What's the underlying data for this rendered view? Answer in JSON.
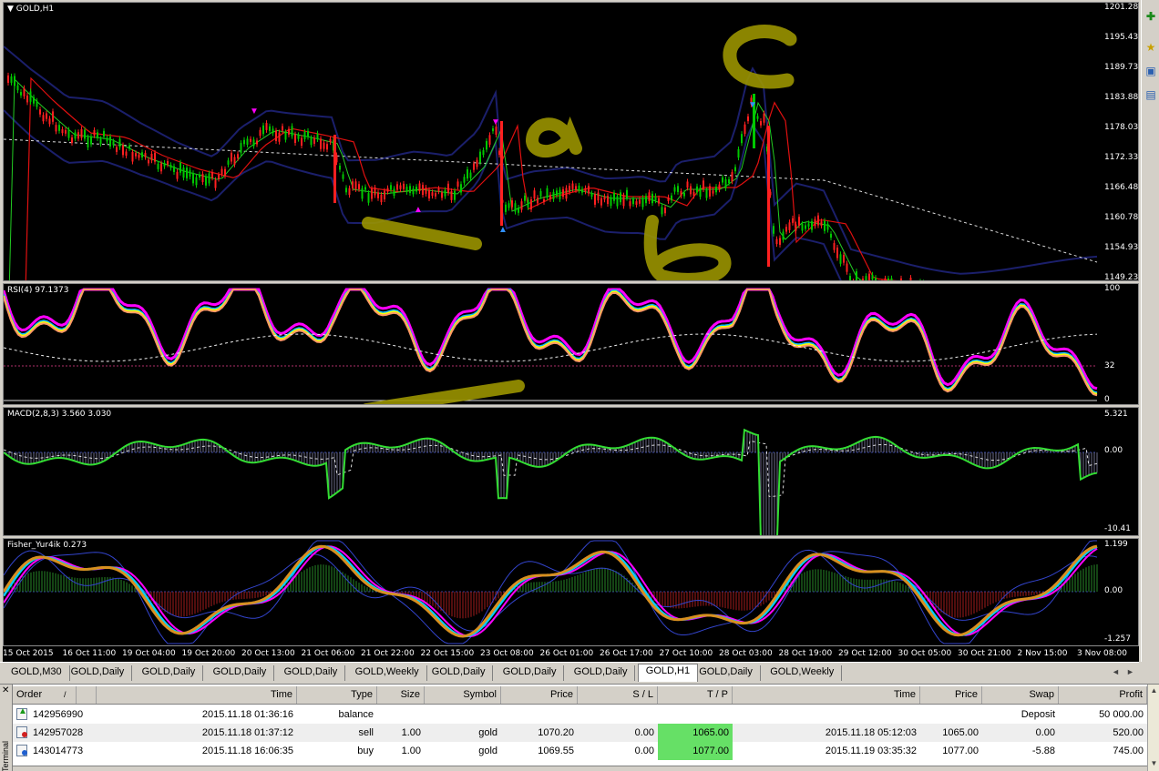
{
  "panes": {
    "main": {
      "label": "GOLD,H1",
      "price_labels": [
        "1201.28",
        "1195.43",
        "1189.73",
        "1183.88",
        "1178.03",
        "1172.33",
        "1166.48",
        "1160.78",
        "1154.93",
        "1149.23"
      ],
      "annotations": [
        "c",
        "a",
        "b"
      ]
    },
    "rsi": {
      "label": "RSI(4) 97.1373",
      "levels": [
        "100",
        "32",
        "0"
      ]
    },
    "macd": {
      "label": "MACD(2,8,3) 3.560 3.030",
      "levels": [
        "5.321",
        "0.00",
        "-10.41"
      ]
    },
    "fisher": {
      "label": "Fisher_Yur4ik 0.273",
      "levels": [
        "1.199",
        "0.00",
        "-1.257"
      ]
    }
  },
  "time_labels": [
    "15 Oct 2015",
    "16 Oct 11:00",
    "19 Oct 04:00",
    "19 Oct 20:00",
    "20 Oct 13:00",
    "21 Oct 06:00",
    "21 Oct 22:00",
    "22 Oct 15:00",
    "23 Oct 08:00",
    "26 Oct 01:00",
    "26 Oct 17:00",
    "27 Oct 10:00",
    "28 Oct 03:00",
    "28 Oct 19:00",
    "29 Oct 12:00",
    "30 Oct 05:00",
    "30 Oct 21:00",
    "2 Nov 15:00",
    "3 Nov 08:00"
  ],
  "chart_tabs": [
    "GOLD,M30",
    "GOLD,Daily",
    "GOLD,Daily",
    "GOLD,Daily",
    "GOLD,Daily",
    "GOLD,Weekly",
    "GOLD,Daily",
    "GOLD,Daily",
    "GOLD,Daily",
    "GOLD,H1",
    "GOLD,Daily",
    "GOLD,Weekly"
  ],
  "active_tab_index": 9,
  "terminal": {
    "side_label": "Terminal",
    "columns": [
      "Order",
      "Time",
      "Type",
      "Size",
      "Symbol",
      "Price",
      "S / L",
      "T / P",
      "Time",
      "Price",
      "Swap",
      "Profit"
    ],
    "sort_indicator": "/",
    "rows": [
      {
        "order": "142956990",
        "time": "2015.11.18 01:36:16",
        "type": "balance",
        "size": "",
        "symbol": "",
        "price": "",
        "sl": "",
        "tp": "",
        "close_time": "",
        "close_price": "",
        "swap": "Deposit",
        "profit": "50 000.00",
        "icon": "balance-icon"
      },
      {
        "order": "142957028",
        "time": "2015.11.18 01:37:12",
        "type": "sell",
        "size": "1.00",
        "symbol": "gold",
        "price": "1070.20",
        "sl": "0.00",
        "tp": "1065.00",
        "close_time": "2015.11.18 05:12:03",
        "close_price": "1065.00",
        "swap": "0.00",
        "profit": "520.00",
        "icon": "sell-icon"
      },
      {
        "order": "143014773",
        "time": "2015.11.18 16:06:35",
        "type": "buy",
        "size": "1.00",
        "symbol": "gold",
        "price": "1069.55",
        "sl": "0.00",
        "tp": "1077.00",
        "close_time": "2015.11.19 03:35:32",
        "close_price": "1077.00",
        "swap": "-5.88",
        "profit": "745.00",
        "icon": "buy-icon"
      }
    ]
  },
  "colors": {
    "background": "#000000",
    "bull": "#00c800",
    "bear": "#ff0000",
    "annotation": "#9a9400",
    "tp_highlight": "#66e066",
    "macd": "#33dd33"
  }
}
